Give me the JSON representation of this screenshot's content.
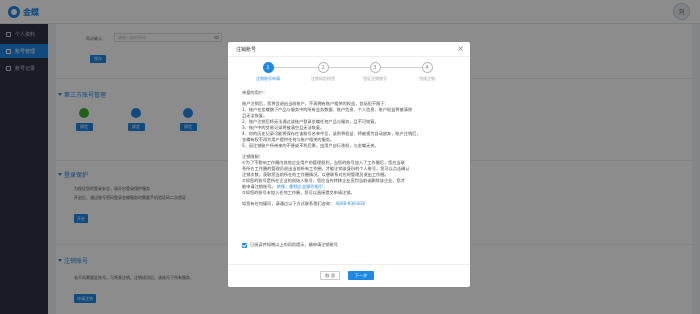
{
  "header": {
    "logo_text": "金蝶",
    "avatar_text": "刘"
  },
  "sidebar": {
    "items": [
      {
        "label": "个人资料"
      },
      {
        "label": "账号管理"
      },
      {
        "label": "账号记录"
      }
    ]
  },
  "account": {
    "password_confirm_label": "再次确认：",
    "password_confirm_placeholder": "请输入新的密码",
    "save_button": "保存",
    "third_party_title": "第三方账号管理",
    "third_party": [
      {
        "name": "wechat",
        "bind_label": "绑定",
        "color": "#3cb034"
      },
      {
        "name": "qq",
        "bind_label": "绑定",
        "color": "#1e88e5"
      },
      {
        "name": "weibo",
        "bind_label": "绑定",
        "color": "#1e88e5"
      }
    ],
    "login_protect_title": "登录保护",
    "login_protect_desc1": "为保证您的登录安全，请开启登录保护服务",
    "login_protect_desc2": "开启后，通过账号密码登录金蝶服务时需要手机验证码二次验证",
    "login_protect_button": "开启",
    "cancel_title": "注销账号",
    "cancel_desc": "若不再需要此账号，可将其注销。注销成功后，该账号下所有服务、",
    "cancel_button": "申请注销"
  },
  "modal": {
    "title": "注销账号",
    "close_glyph": "×",
    "steps": [
      {
        "number": "1",
        "label": "注销账号申请"
      },
      {
        "number": "2",
        "label": "注销风险校验"
      },
      {
        "number": "3",
        "label": "验证注销账号"
      },
      {
        "number": "4",
        "label": "完成注销"
      }
    ],
    "greeting": "亲爱的用户：",
    "intro": "账户注销后，您将会退出当前账户，不再拥有账户相关的权益，包括但不限于：",
    "items": [
      "1、账户在金蝶旗下产品与服务中的所有业务数据、账户信息、个人信息、账户权益将被清除",
      "且无法恢复。",
      "2、账户注销后将无法通过该账户登录金蝶任何产品与服务，且不可恢复。",
      "3、账户中的交易记录将被清空且无法恢复。",
      "4、你的历史记录可能将保存在该账号名单中至，该则将权益、将被视为自动放弃，账户注销后，",
      "金蝶有权不再为用户提供任何与账户相关的服务。",
      "5、因注销账户所带来的不便或不利后果，由用户自行承担，与金蝶无关。"
    ],
    "note_title": "注销限制：",
    "notes": [
      "①为了不影响工作圈内其他企业用户的管理权利，当您的账号加入了工作圈后，您应当联",
      "系所在工作圈的管理员退出当前所有工作圈，才能注销该身份的个人账号，您可以点击确认",
      "注销次数，获取您当前所在的工作圈情况，以便联系对应的管理员退出工作圈。"
    ],
    "note2_prefix": "②如您的账号是所在企业的创始人账号，您应当先转移企业宣判当前或删除该企业，您才",
    "note2_line2_text": "能申请注销账号。",
    "note2_link": "转移、删除企业操作指引",
    "note3": "③如您的账号未加入任何工作圈，您可以直接提交申请注销。",
    "contact_text": "如您有任何疑问，请通过以下方式联系我们咨询：",
    "contact_phone": "4008-836-836",
    "agree_text": "已阅读并知晓以上的风险提示，确申请注销账号",
    "cancel_button": "取 消",
    "next_button": "下一步"
  }
}
